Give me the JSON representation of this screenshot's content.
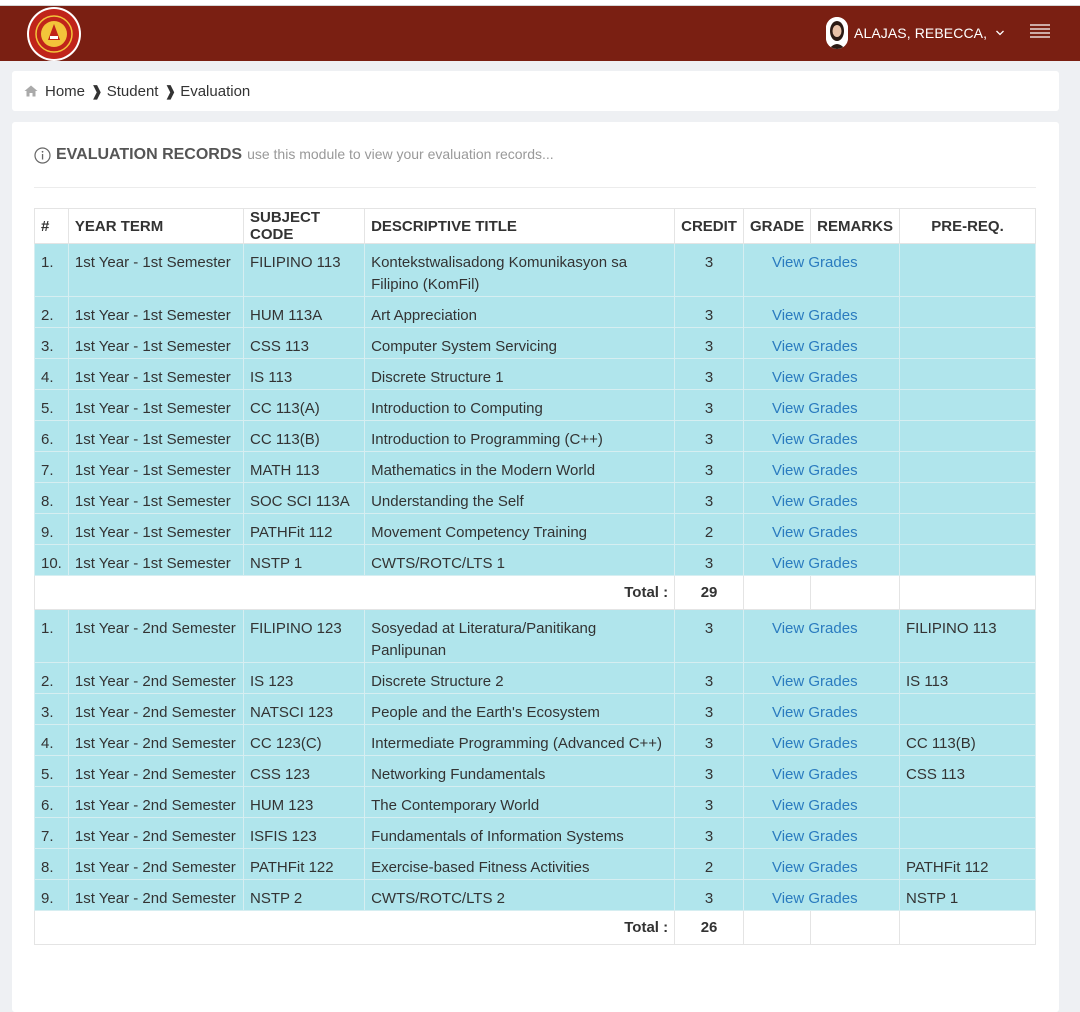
{
  "header": {
    "user_name": "ALAJAS, REBECCA,",
    "colors": {
      "navbar": "#7a1f12",
      "row": "#b0e5ec",
      "link": "#2a7bbf"
    }
  },
  "breadcrumb": {
    "home": "Home",
    "student": "Student",
    "evaluation": "Evaluation"
  },
  "panel": {
    "title": "EVALUATION RECORDS",
    "subtitle": "use this module to view your evaluation records..."
  },
  "table": {
    "headers": [
      "#",
      "YEAR TERM",
      "SUBJECT CODE",
      "DESCRIPTIVE TITLE",
      "CREDIT",
      "GRADE",
      "REMARKS",
      "PRE-REQ."
    ],
    "link_label": "View Grades",
    "total_label": "Total :",
    "groups": [
      {
        "rows": [
          {
            "num": "1.",
            "term": "1st Year - 1st Semester",
            "code": "FILIPINO 113",
            "title": "Kontekstwalisadong Komunikasyon sa Filipino (KomFil)",
            "credit": "3",
            "prereq": ""
          },
          {
            "num": "2.",
            "term": "1st Year - 1st Semester",
            "code": "HUM 113A",
            "title": "Art Appreciation",
            "credit": "3",
            "prereq": ""
          },
          {
            "num": "3.",
            "term": "1st Year - 1st Semester",
            "code": "CSS 113",
            "title": "Computer System Servicing",
            "credit": "3",
            "prereq": ""
          },
          {
            "num": "4.",
            "term": "1st Year - 1st Semester",
            "code": "IS 113",
            "title": "Discrete Structure 1",
            "credit": "3",
            "prereq": ""
          },
          {
            "num": "5.",
            "term": "1st Year - 1st Semester",
            "code": "CC 113(A)",
            "title": "Introduction to Computing",
            "credit": "3",
            "prereq": ""
          },
          {
            "num": "6.",
            "term": "1st Year - 1st Semester",
            "code": "CC 113(B)",
            "title": "Introduction to Programming (C++)",
            "credit": "3",
            "prereq": ""
          },
          {
            "num": "7.",
            "term": "1st Year - 1st Semester",
            "code": "MATH 113",
            "title": "Mathematics in the Modern World",
            "credit": "3",
            "prereq": ""
          },
          {
            "num": "8.",
            "term": "1st Year - 1st Semester",
            "code": "SOC SCI 113A",
            "title": "Understanding the Self",
            "credit": "3",
            "prereq": ""
          },
          {
            "num": "9.",
            "term": "1st Year - 1st Semester",
            "code": "PATHFit 112",
            "title": "Movement Competency Training",
            "credit": "2",
            "prereq": ""
          },
          {
            "num": "10.",
            "term": "1st Year - 1st Semester",
            "code": "NSTP 1",
            "title": "CWTS/ROTC/LTS 1",
            "credit": "3",
            "prereq": ""
          }
        ],
        "total": "29"
      },
      {
        "rows": [
          {
            "num": "1.",
            "term": "1st Year - 2nd Semester",
            "code": "FILIPINO 123",
            "title": "Sosyedad at Literatura/Panitikang Panlipunan",
            "credit": "3",
            "prereq": "FILIPINO 113"
          },
          {
            "num": "2.",
            "term": "1st Year - 2nd Semester",
            "code": "IS 123",
            "title": "Discrete Structure 2",
            "credit": "3",
            "prereq": "IS 113"
          },
          {
            "num": "3.",
            "term": "1st Year - 2nd Semester",
            "code": "NATSCI 123",
            "title": "People and the Earth's Ecosystem",
            "credit": "3",
            "prereq": ""
          },
          {
            "num": "4.",
            "term": "1st Year - 2nd Semester",
            "code": "CC 123(C)",
            "title": "Intermediate Programming (Advanced C++)",
            "credit": "3",
            "prereq": "CC 113(B)"
          },
          {
            "num": "5.",
            "term": "1st Year - 2nd Semester",
            "code": "CSS 123",
            "title": "Networking Fundamentals",
            "credit": "3",
            "prereq": "CSS 113"
          },
          {
            "num": "6.",
            "term": "1st Year - 2nd Semester",
            "code": "HUM 123",
            "title": "The Contemporary World",
            "credit": "3",
            "prereq": ""
          },
          {
            "num": "7.",
            "term": "1st Year - 2nd Semester",
            "code": "ISFIS 123",
            "title": "Fundamentals of Information Systems",
            "credit": "3",
            "prereq": ""
          },
          {
            "num": "8.",
            "term": "1st Year - 2nd Semester",
            "code": "PATHFit 122",
            "title": "Exercise-based Fitness Activities",
            "credit": "2",
            "prereq": "PATHFit 112"
          },
          {
            "num": "9.",
            "term": "1st Year - 2nd Semester",
            "code": "NSTP 2",
            "title": "CWTS/ROTC/LTS 2",
            "credit": "3",
            "prereq": "NSTP 1"
          }
        ],
        "total": "26"
      }
    ]
  }
}
